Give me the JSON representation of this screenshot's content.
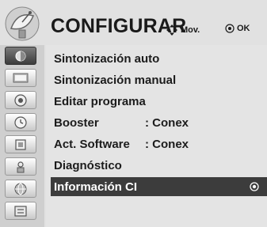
{
  "header": {
    "title": "CONFIGURAR",
    "hint_move": "Mov.",
    "hint_ok": "OK"
  },
  "sidebar": {
    "items": [
      {
        "icon": "picture-icon",
        "active": true
      },
      {
        "icon": "tv-screen-icon",
        "active": false
      },
      {
        "icon": "speaker-icon",
        "active": false
      },
      {
        "icon": "clock-icon",
        "active": false
      },
      {
        "icon": "lock-icon",
        "active": false
      },
      {
        "icon": "input-icon",
        "active": false
      },
      {
        "icon": "globe-icon",
        "active": false
      },
      {
        "icon": "options-icon",
        "active": false
      }
    ]
  },
  "menu": {
    "items": [
      {
        "label": "Sintonización auto",
        "value": ""
      },
      {
        "label": "Sintonización manual",
        "value": ""
      },
      {
        "label": "Editar programa",
        "value": ""
      },
      {
        "label": "Booster",
        "value": ": Conex"
      },
      {
        "label": "Act. Software",
        "value": ": Conex"
      },
      {
        "label": "Diagnóstico",
        "value": ""
      },
      {
        "label": "Información CI",
        "value": "",
        "selected": true
      }
    ]
  },
  "colors": {
    "selected_bg": "#3c3c3c",
    "menu_bg": "#e4e4e4",
    "sidebar_bg": "#cfcfcf"
  }
}
